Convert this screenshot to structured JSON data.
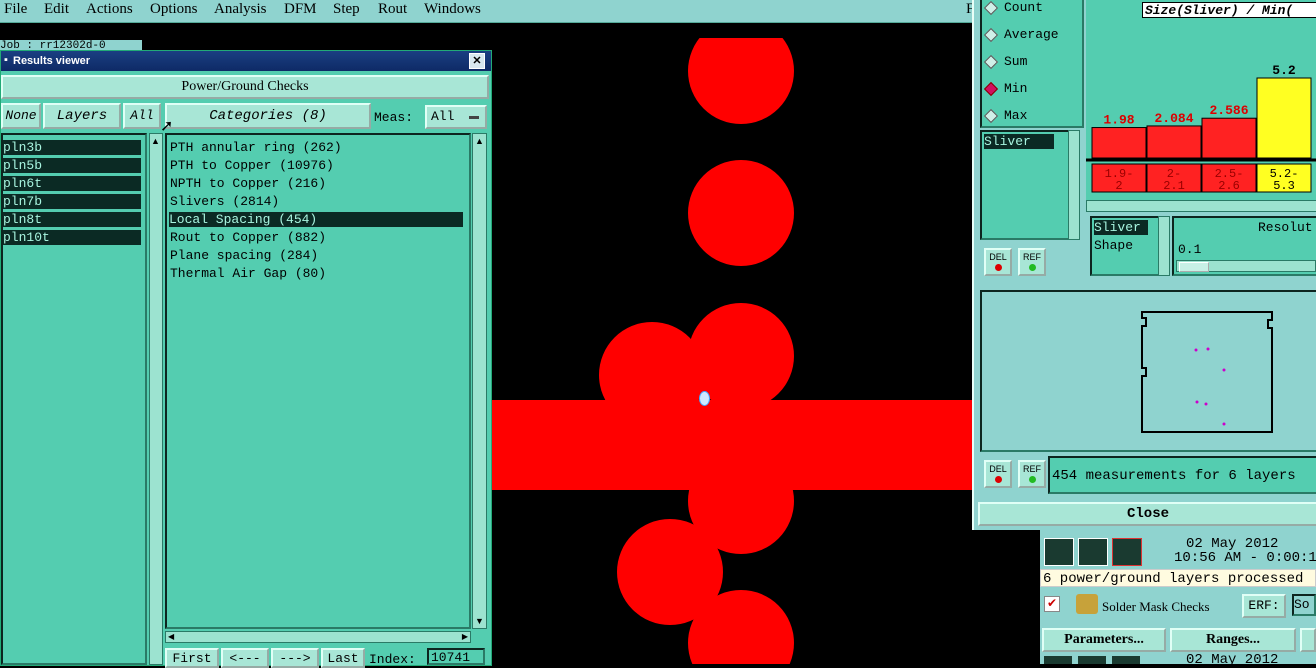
{
  "menu": [
    "File",
    "Edit",
    "Actions",
    "Options",
    "Analysis",
    "DFM",
    "Step",
    "Rout",
    "Windows"
  ],
  "menu_extra": "F",
  "job_label": "Job : rr12302d-0",
  "results_viewer": {
    "title": "Results viewer",
    "close_glyph": "✕",
    "heading": "Power/Ground Checks",
    "none_btn": "None",
    "layers_btn": "Layers",
    "all_btn": "All",
    "categories_btn": "Categories (8)",
    "meas_label": "Meas:",
    "meas_value": "All",
    "layers": [
      "pln3b",
      "pln5b",
      "pln6t",
      "pln7b",
      "pln8t",
      "pln10t"
    ],
    "categories": [
      "PTH annular ring (262)",
      "PTH to Copper (10976)",
      "NPTH to Copper (216)",
      "Slivers (2814)",
      "Local Spacing (454)",
      "Rout to Copper (882)",
      "Plane spacing (284)",
      "Thermal Air Gap (80)"
    ],
    "selected_category": "Local Spacing (454)",
    "first_btn": "First",
    "prev_btn": "<---",
    "next_btn": "--->",
    "last_btn": "Last",
    "index_label": "Index:",
    "index_value": "10741"
  },
  "stats_panel": {
    "modes": [
      "Count",
      "Average",
      "Sum",
      "Min",
      "Max"
    ],
    "selected_mode": "Min",
    "type_item": "Sliver",
    "chart_title": "Size(Sliver) / Min(",
    "bar_labels": [
      "1.98",
      "2.084",
      "2.586",
      "5.2"
    ],
    "bin_labels": [
      [
        "1.9-",
        "2"
      ],
      [
        "2-",
        "2.1"
      ],
      [
        "2.5-",
        "2.6"
      ],
      [
        "5.2-",
        "5.3"
      ]
    ],
    "colors": {
      "red": "#ff2222",
      "yellow": "#ffff22",
      "label_red": "#dd0000"
    },
    "shape_items": [
      "Sliver",
      "Shape"
    ],
    "resolution_label": "Resolut",
    "resolution_value": "0.1",
    "del_label": "DEL",
    "ref_label": "REF",
    "measurements_text": "454 measurements for 6 layers",
    "close_btn": "Close"
  },
  "status_area": {
    "date": "02 May 2012",
    "time": "10:56 AM - 0:00:1",
    "message": "6 power/ground layers processed",
    "solder_mask": "Solder Mask Checks",
    "erf_label": "ERF:",
    "erf_value": "So",
    "parameters_btn": "Parameters...",
    "ranges_btn": "Ranges...",
    "date2": "02 May 2012"
  }
}
